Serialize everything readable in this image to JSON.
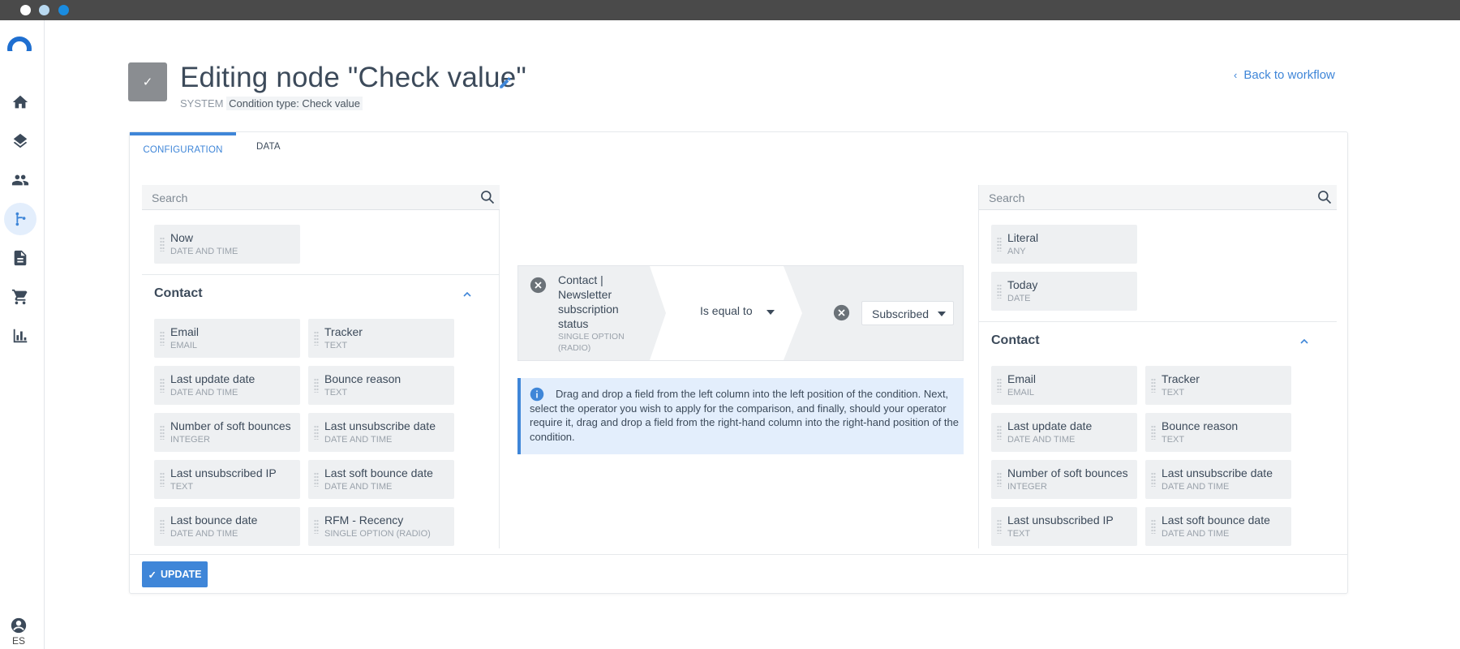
{
  "header": {
    "title": "Editing node \"Check value\"",
    "system_label": "SYSTEM",
    "condition_type": "Condition type: Check value",
    "back_link": "Back to workflow"
  },
  "rail": {
    "items": [
      "home-icon",
      "layers-icon",
      "contacts-icon",
      "workflow-icon",
      "document-icon",
      "cart-icon",
      "chart-icon"
    ],
    "active": "workflow-icon",
    "language": "ES"
  },
  "tabs": [
    "CONFIGURATION",
    "DATA"
  ],
  "left_panel": {
    "search_placeholder": "Search",
    "top_fields": [
      {
        "name": "Now",
        "type": "DATE AND TIME"
      }
    ],
    "group_title": "Contact",
    "fields": [
      {
        "name": "Email",
        "type": "EMAIL"
      },
      {
        "name": "Tracker",
        "type": "TEXT"
      },
      {
        "name": "Last update date",
        "type": "DATE AND TIME"
      },
      {
        "name": "Bounce reason",
        "type": "TEXT"
      },
      {
        "name": "Number of soft bounces",
        "type": "INTEGER"
      },
      {
        "name": "Last unsubscribe date",
        "type": "DATE AND TIME"
      },
      {
        "name": "Last unsubscribed IP",
        "type": "TEXT"
      },
      {
        "name": "Last soft bounce date",
        "type": "DATE AND TIME"
      },
      {
        "name": "Last bounce date",
        "type": "DATE AND TIME"
      },
      {
        "name": "RFM - Recency",
        "type": "SINGLE OPTION (RADIO)"
      }
    ]
  },
  "condition": {
    "left_field": "Contact | Newsletter subscription status",
    "left_type": "SINGLE OPTION (RADIO)",
    "operator": "Is equal to",
    "value": "Subscribed"
  },
  "info_text": "Drag and drop a field from the left column into the left position of the condition. Next, select the operator you wish to apply for the comparison, and finally, should your operator require it, drag and drop a field from the right-hand column into the right-hand position of the condition.",
  "right_panel": {
    "search_placeholder": "Search",
    "top_fields": [
      {
        "name": "Literal",
        "type": "ANY"
      },
      {
        "name": "Today",
        "type": "DATE"
      }
    ],
    "group_title": "Contact",
    "fields": [
      {
        "name": "Email",
        "type": "EMAIL"
      },
      {
        "name": "Tracker",
        "type": "TEXT"
      },
      {
        "name": "Last update date",
        "type": "DATE AND TIME"
      },
      {
        "name": "Bounce reason",
        "type": "TEXT"
      },
      {
        "name": "Number of soft bounces",
        "type": "INTEGER"
      },
      {
        "name": "Last unsubscribe date",
        "type": "DATE AND TIME"
      },
      {
        "name": "Last unsubscribed IP",
        "type": "TEXT"
      },
      {
        "name": "Last soft bounce date",
        "type": "DATE AND TIME"
      }
    ]
  },
  "footer": {
    "update_label": "UPDATE"
  },
  "colors": {
    "accent": "#3f86d8",
    "badge": "#8a8d91",
    "info_bg": "#e3eefc"
  }
}
